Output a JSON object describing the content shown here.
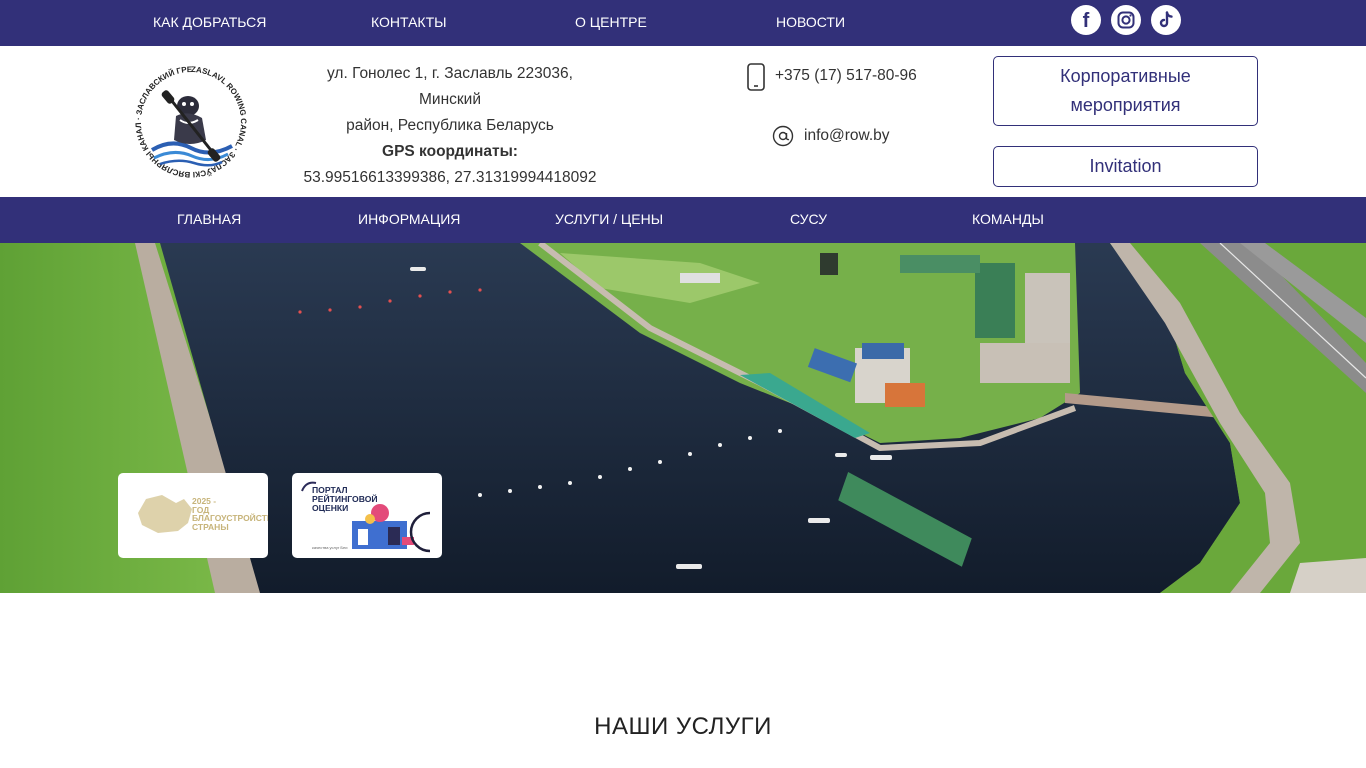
{
  "top_nav": {
    "items": [
      {
        "label": "КАК ДОБРАТЬСЯ"
      },
      {
        "label": "КОНТАКТЫ"
      },
      {
        "label": "О ЦЕНТРЕ"
      },
      {
        "label": "НОВОСТИ"
      }
    ],
    "social": [
      {
        "icon": "facebook-icon",
        "glyph": "f"
      },
      {
        "icon": "instagram-icon"
      },
      {
        "icon": "tiktok-icon",
        "glyph": "♪"
      }
    ]
  },
  "header": {
    "logo": {
      "ring_text": "ZASLAVL ROWING CANAL · ЗАСЛАЎСКІ ВЯСЛЯРНЫ КАНАЛ · ЗАСЛАВСКИЙ ГРЕБНОЙ КАНАЛ"
    },
    "address_line1": "ул. Гонолес 1, г. Заславль 223036, Минский",
    "address_line2": "район, Республика Беларусь",
    "gps_label": "GPS координаты:",
    "gps_value": "53.99516613399386, 27.31319994418092",
    "phone": "+375 (17) 517-80-96",
    "email": "info@row.by",
    "corporate_button_line1": "Корпоративные",
    "corporate_button_line2": "мероприятия",
    "invitation_button": "Invitation"
  },
  "main_nav": {
    "items": [
      {
        "label": "ГЛАВНАЯ"
      },
      {
        "label": "ИНФОРМАЦИЯ"
      },
      {
        "label": "УСЛУГИ / ЦЕНЫ"
      },
      {
        "label": "СУСУ"
      },
      {
        "label": "КОМАНДЫ"
      }
    ]
  },
  "banners": {
    "year_banner": {
      "line1": "2025 -",
      "line2": "ГОД",
      "line3": "БЛАГОУСТРОЙСТВА",
      "line4": "СТРАНЫ",
      "color": "#d3c38f"
    },
    "portal_banner": {
      "line1": "ПОРТАЛ",
      "line2": "РЕЙТИНГОВОЙ",
      "line3": "ОЦЕНКИ",
      "caption": "качества услуг Беи"
    }
  },
  "section": {
    "title": "НАШИ УСЛУГИ"
  },
  "colors": {
    "brand": "#323079",
    "water": "#1b2a3e",
    "grass": "#6fae3e"
  }
}
